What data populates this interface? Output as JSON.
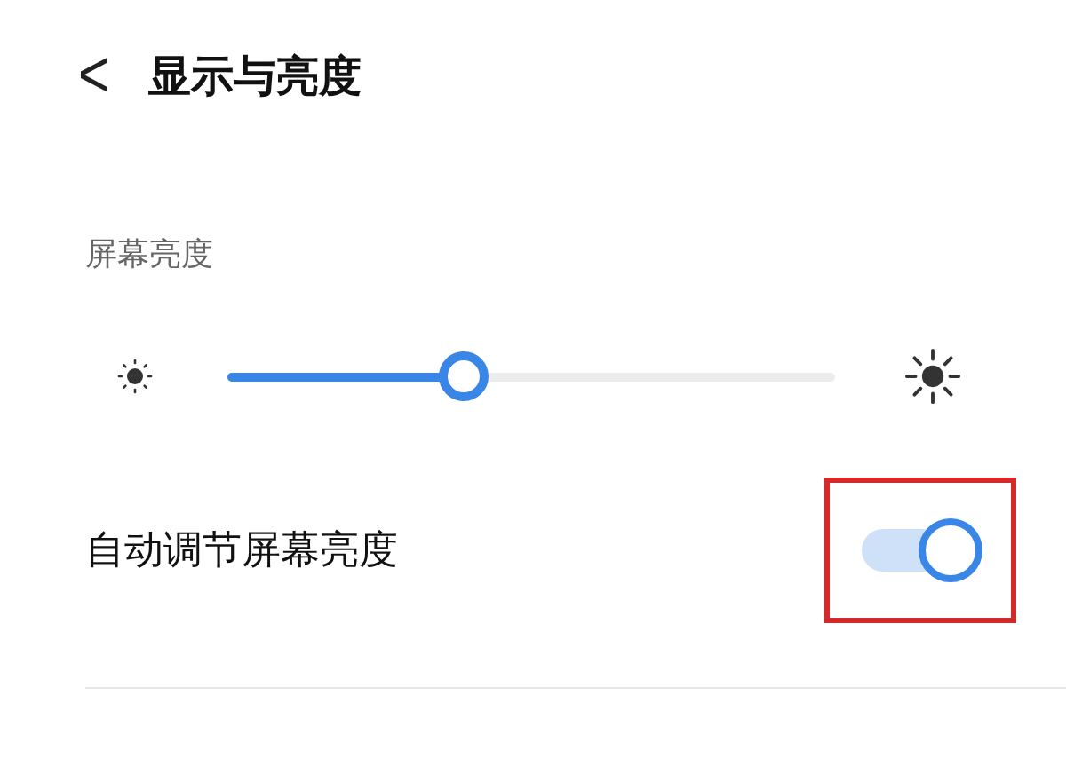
{
  "header": {
    "back": "<",
    "title": "显示与亮度"
  },
  "brightness": {
    "label": "屏幕亮度",
    "level": 0.39
  },
  "auto_brightness": {
    "label": "自动调节屏幕亮度",
    "on": true,
    "highlighted": true
  }
}
